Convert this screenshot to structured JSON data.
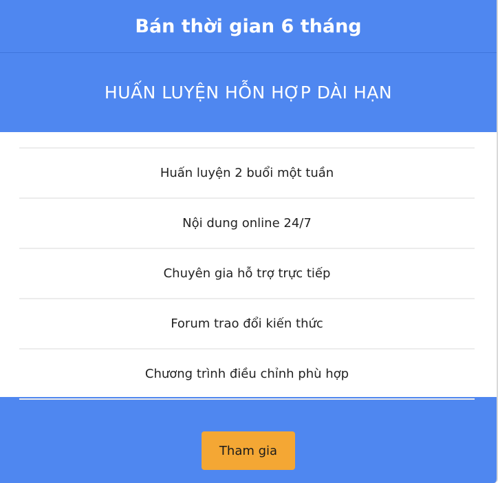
{
  "plan": {
    "title": "Bán thời gian 6 tháng",
    "subtitle": "HUẤN LUYỆN HỖN HỢP DÀI HẠN",
    "features": [
      "Huấn luyện 2 buổi một tuần",
      "Nội dung online 24/7",
      "Chuyên gia hỗ trợ trực tiếp",
      "Forum trao đổi kiến thức",
      "Chương trình điều chỉnh phù hợp"
    ],
    "button_label": "Tham gia"
  },
  "colors": {
    "header_blue": "#4f87f0",
    "button_orange": "#f4a734"
  }
}
